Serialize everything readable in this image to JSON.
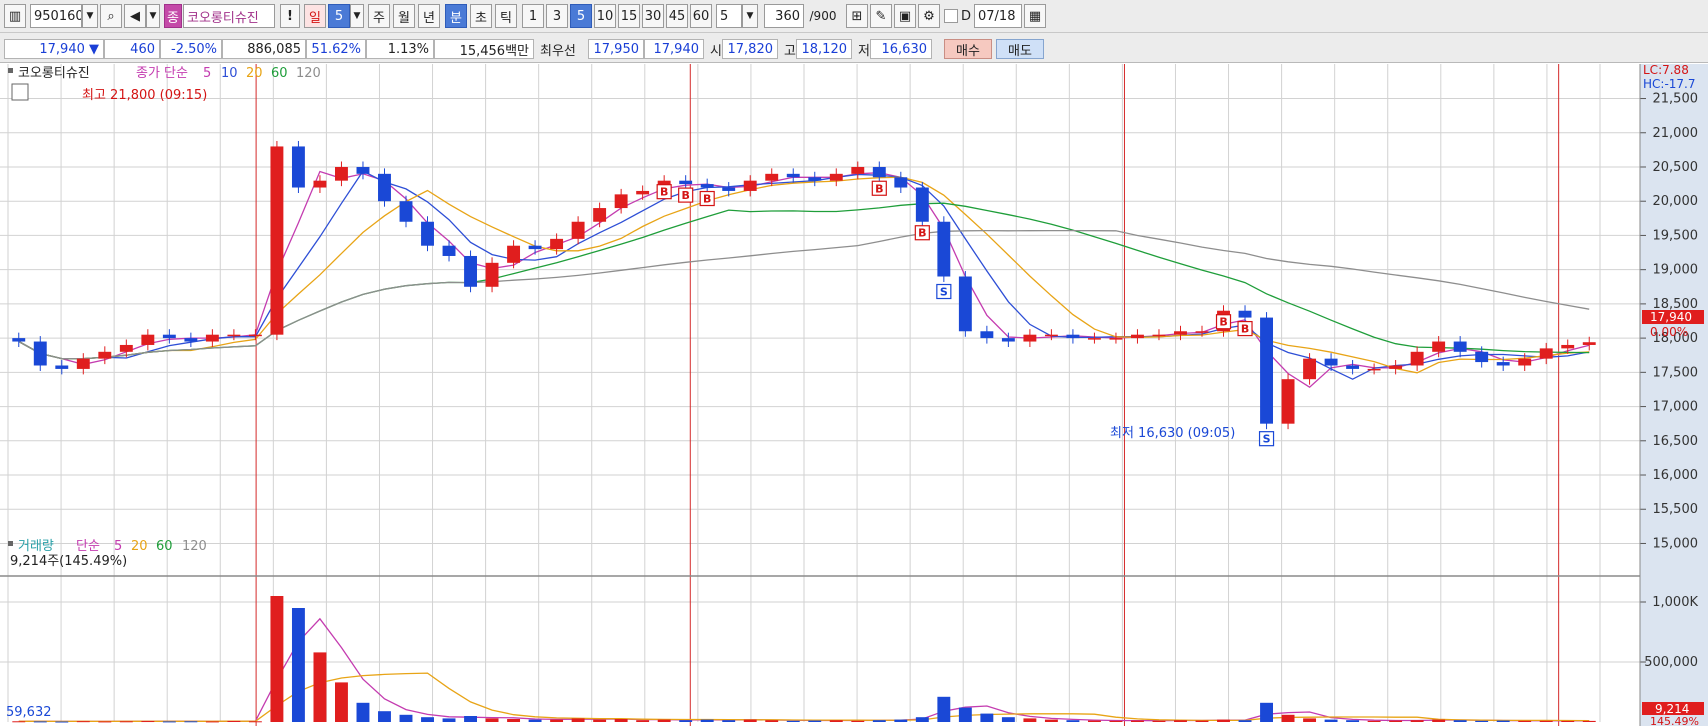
{
  "toolbar": {
    "code": "950160",
    "stock_name": "코오롱티슈진",
    "stock_tag": "종",
    "alert": "!",
    "period_day": "일",
    "period_day_num": "5",
    "period_week": "주",
    "period_month": "월",
    "period_year": "년",
    "period_minute": "분",
    "period_second": "초",
    "period_tick": "틱",
    "minute_options": [
      "1",
      "3",
      "5",
      "10",
      "15",
      "30",
      "45",
      "60"
    ],
    "selected_minute": "5",
    "count_value": "5",
    "bars_value": "360",
    "bars_total": "/900",
    "d_label": "D",
    "date_value": "07/18"
  },
  "info": {
    "price": "17,940 ▼",
    "change": "460",
    "change_pct": "-2.50%",
    "volume": "886,085",
    "vol_ratio": "51.62%",
    "turnover": "1.13%",
    "amount": "15,456백만",
    "best_label": "최우선",
    "best_ask": "17,950",
    "best_bid": "17,940",
    "open_label": "시",
    "open": "17,820",
    "high_label": "고",
    "high": "18,120",
    "low_label": "저",
    "low": "16,630",
    "buy": "매수",
    "sell": "매도"
  },
  "chart_data": {
    "type": "candlestick",
    "price_panel": {
      "legend": {
        "name": "코오롱티슈진",
        "series_label": "종가 단순",
        "ma": [
          "5",
          "10",
          "20",
          "60",
          "120"
        ]
      },
      "y_ticks": [
        "21,500",
        "21,000",
        "20,500",
        "20,000",
        "19,500",
        "19,000",
        "18,500",
        "18,000",
        "17,500",
        "17,000",
        "16,500",
        "16,000",
        "15,500",
        "15,000"
      ],
      "ylim": [
        14700,
        21800
      ],
      "last_price_label": "17,940",
      "last_pct_label": "0.00%",
      "lc_label": "LC:7.88",
      "hc_label": "HC:-17.7",
      "high_annotation": "최고 21,800 (09:15)",
      "low_annotation": "최저 16,630 (09:05)",
      "marker_labels": [
        "B",
        "S"
      ],
      "close_series": [
        17950,
        17600,
        17550,
        17700,
        17800,
        17900,
        18050,
        18000,
        17950,
        18050,
        18050,
        18050,
        20800,
        20200,
        20300,
        20500,
        20400,
        20000,
        19700,
        19350,
        19200,
        18750,
        19100,
        19350,
        19300,
        19450,
        19700,
        19900,
        20100,
        20150,
        20300,
        20250,
        20200,
        20150,
        20300,
        20400,
        20350,
        20300,
        20400,
        20500,
        20350,
        20200,
        19700,
        18900,
        18100,
        18000,
        17950,
        18050,
        18050,
        18000,
        18000,
        18000,
        18050,
        18050,
        18100,
        18100,
        18400,
        18300,
        16750,
        17400,
        17700,
        17600,
        17550,
        17550,
        17600,
        17800,
        17950,
        17800,
        17650,
        17600,
        17700,
        17850,
        17900,
        17940
      ]
    },
    "volume_panel": {
      "legend": {
        "name": "거래량",
        "series_label": "단순",
        "ma": [
          "5",
          "20",
          "60",
          "120"
        ]
      },
      "y_ticks": [
        "1,000K",
        "500,000"
      ],
      "ylim": [
        0,
        1100000
      ],
      "current_volume_label": "9,214주(145.49%)",
      "left_value_label": "59,632",
      "last_volume_label": "9,214",
      "last_volume_pct": "145.49%",
      "volume_series": [
        6000,
        5000,
        4000,
        7000,
        5000,
        6000,
        8000,
        5000,
        6000,
        5000,
        9000,
        6000,
        1050000,
        950000,
        580000,
        330000,
        160000,
        90000,
        60000,
        40000,
        30000,
        50000,
        30000,
        25000,
        20000,
        20000,
        30000,
        20000,
        25000,
        15000,
        20000,
        15000,
        20000,
        15000,
        20000,
        15000,
        10000,
        12000,
        15000,
        10000,
        15000,
        20000,
        40000,
        210000,
        120000,
        70000,
        40000,
        30000,
        20000,
        15000,
        12000,
        10000,
        12000,
        10000,
        15000,
        12000,
        20000,
        15000,
        160000,
        60000,
        30000,
        20000,
        15000,
        10000,
        12000,
        15000,
        20000,
        15000,
        10000,
        12000,
        10000,
        10000,
        9000,
        9214
      ]
    },
    "colors": {
      "up": "#e01e1e",
      "down": "#1a48d6",
      "ma5": "#c43cb0",
      "ma10": "#2e4fd6",
      "ma20": "#e8a416",
      "ma60": "#1f9e3a",
      "ma120": "#8e8e8e",
      "grid": "#d2d2d2",
      "axis_bg": "#dbe4f0"
    }
  }
}
